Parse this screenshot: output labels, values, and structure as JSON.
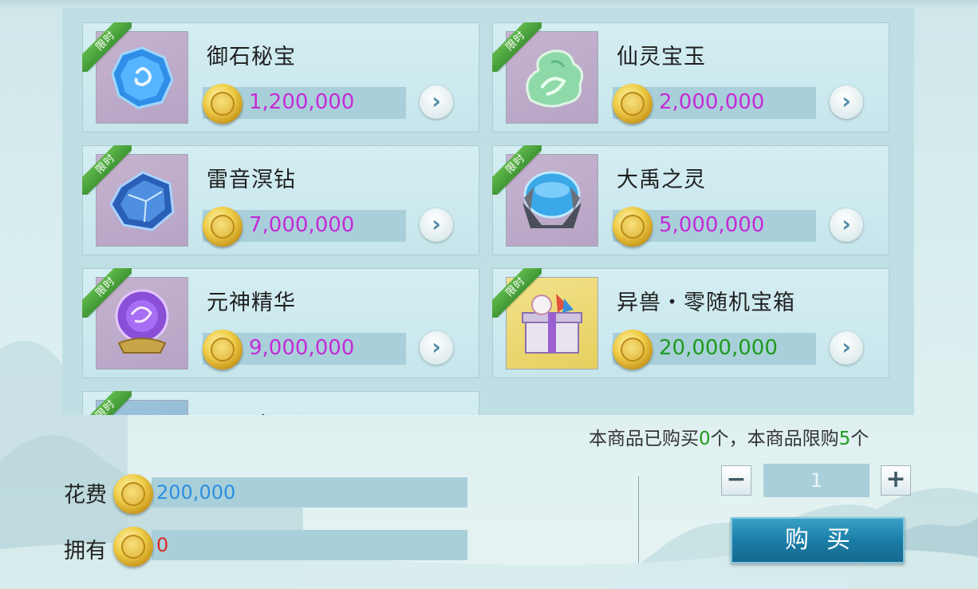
{
  "shop": {
    "ribbon": "限时",
    "items": [
      {
        "name": "御石秘宝",
        "price": "1,200,000",
        "price_color": "#c42bd6",
        "thumb": "blue-crystal-stone"
      },
      {
        "name": "仙灵宝玉",
        "price": "2,000,000",
        "price_color": "#c42bd6",
        "thumb": "green-jade"
      },
      {
        "name": "雷音溟钻",
        "price": "7,000,000",
        "price_color": "#c42bd6",
        "thumb": "blue-diamond-shard"
      },
      {
        "name": "大禹之灵",
        "price": "5,000,000",
        "price_color": "#c42bd6",
        "thumb": "water-orb-in-stone"
      },
      {
        "name": "元神精华",
        "price": "9,000,000",
        "price_color": "#c42bd6",
        "thumb": "purple-dragon-orb"
      },
      {
        "name": "异兽・零随机宝箱",
        "price": "20,000,000",
        "price_color": "#1e9a1e",
        "thumb": "gift-box"
      },
      {
        "name": "_面_金_柔",
        "price": "",
        "thumb": "partially-hidden"
      }
    ],
    "arrow_glyph": "›"
  },
  "purchase_info": {
    "prefix": "本商品已购买",
    "bought": "0",
    "mid": "个，本商品限购",
    "limit": "5",
    "suffix": "个"
  },
  "cost": {
    "label": "花费",
    "value": "200,000"
  },
  "owned": {
    "label": "拥有",
    "value": "0"
  },
  "quantity": {
    "minus": "−",
    "value": "1",
    "plus": "+"
  },
  "buy_button": "购买",
  "colors": {
    "accent_blue": "#1b7ea8",
    "limited_ribbon": "#4aa63c",
    "price_purple": "#c42bd6",
    "price_green": "#1e9a1e"
  }
}
